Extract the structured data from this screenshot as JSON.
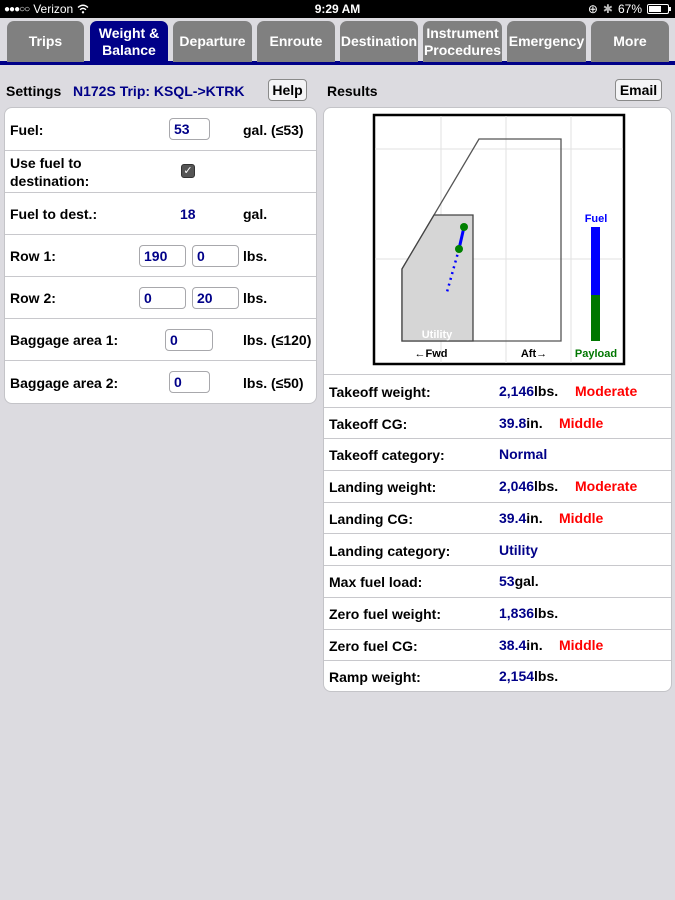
{
  "status_bar": {
    "signal": "●●●○○",
    "carrier": "Verizon",
    "wifi_icon": "wifi-icon",
    "time": "9:29 AM",
    "orientation_lock_icon": "⊕",
    "bluetooth_icon": "✱",
    "battery_percent": "67%",
    "battery_level": 0.67
  },
  "tabs": [
    {
      "label": "Trips",
      "active": false
    },
    {
      "label": "Weight &\nBalance",
      "active": true
    },
    {
      "label": "Departure",
      "active": false
    },
    {
      "label": "Enroute",
      "active": false
    },
    {
      "label": "Destination",
      "active": false
    },
    {
      "label": "Instrument\nProcedures",
      "active": false
    },
    {
      "label": "Emergency",
      "active": false
    },
    {
      "label": "More",
      "active": false
    }
  ],
  "colors": {
    "accent": "#000088",
    "tab_inactive": "#808080",
    "warning": "#ff0000",
    "fuel": "#0000ff",
    "payload": "#007700"
  },
  "settings": {
    "heading": "Settings",
    "trip_title": "N172S Trip: KSQL->KTRK",
    "help_label": "Help",
    "fuel": {
      "label": "Fuel:",
      "value": "53",
      "unit": "gal. (≤53)"
    },
    "use_fuel_to_dest": {
      "label_line1": "Use fuel to",
      "label_line2": "destination:",
      "checked": true,
      "check_glyph": "✓"
    },
    "fuel_to_dest": {
      "label": "Fuel to dest.:",
      "value": "18",
      "unit": "gal."
    },
    "row1": {
      "label": "Row 1:",
      "left": "190",
      "right": "0",
      "unit": "lbs."
    },
    "row2": {
      "label": "Row 2:",
      "left": "0",
      "right": "20",
      "unit": "lbs."
    },
    "baggage1": {
      "label": "Baggage area 1:",
      "value": "0",
      "unit": "lbs. (≤120)"
    },
    "baggage2": {
      "label": "Baggage area 2:",
      "value": "0",
      "unit": "lbs. (≤50)"
    }
  },
  "results": {
    "heading": "Results",
    "email_label": "Email",
    "chart": {
      "utility_label": "Utility",
      "fwd_label": "←Fwd",
      "aft_label": "Aft→",
      "fuel_label": "Fuel",
      "payload_label": "Payload",
      "fuel_fraction_of_bar": 0.6
    },
    "rows": [
      {
        "label": "Takeoff weight:",
        "value": "2,146",
        "unit": "lbs.",
        "status": "Moderate"
      },
      {
        "label": "Takeoff CG:",
        "value": "39.8",
        "unit": "in.",
        "status": "Middle"
      },
      {
        "label": "Takeoff category:",
        "value": "Normal",
        "unit": "",
        "status": ""
      },
      {
        "label": "Landing weight:",
        "value": "2,046",
        "unit": "lbs.",
        "status": "Moderate"
      },
      {
        "label": "Landing CG:",
        "value": "39.4",
        "unit": "in.",
        "status": "Middle"
      },
      {
        "label": "Landing category:",
        "value": "Utility",
        "unit": "",
        "status": ""
      },
      {
        "label": "Max fuel load:",
        "value": "53",
        "unit": "gal.",
        "status": ""
      },
      {
        "label": "Zero fuel weight:",
        "value": "1,836",
        "unit": "lbs.",
        "status": ""
      },
      {
        "label": "Zero fuel CG:",
        "value": "38.4",
        "unit": "in.",
        "status": "Middle"
      },
      {
        "label": "Ramp weight:",
        "value": "2,154",
        "unit": "lbs.",
        "status": ""
      }
    ]
  }
}
